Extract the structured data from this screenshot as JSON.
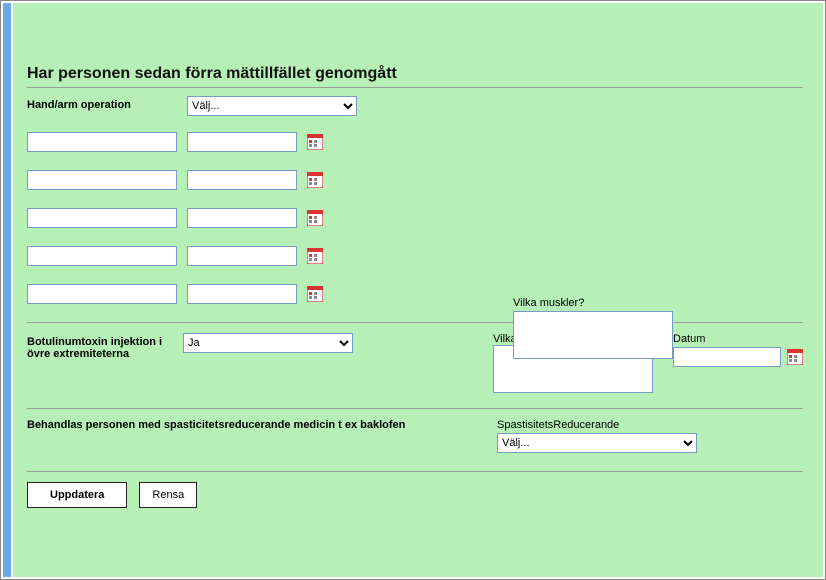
{
  "heading": "Har personen sedan förra mättillfället genomgått",
  "hand_arm": {
    "label": "Hand/arm operation",
    "select_placeholder": "Välj...",
    "rows": [
      {
        "a": "",
        "b": ""
      },
      {
        "a": "",
        "b": ""
      },
      {
        "a": "",
        "b": ""
      },
      {
        "a": "",
        "b": ""
      },
      {
        "a": "",
        "b": ""
      }
    ],
    "muscles_label": "Vilka muskler?",
    "muscles_value": ""
  },
  "botox": {
    "label": "Botulinumtoxin injektion i övre extremiteterna",
    "select_value": "Ja",
    "muscles_label": "Vilka muskler?",
    "muscles_value": "",
    "date_label": "Datum",
    "date_value": ""
  },
  "baklofen": {
    "label": "Behandlas personen med spasticitetsreducerande medicin t ex baklofen",
    "select_label": "SpastisitetsReducerande",
    "select_placeholder": "Välj..."
  },
  "buttons": {
    "update": "Uppdatera",
    "clear": "Rensa"
  }
}
